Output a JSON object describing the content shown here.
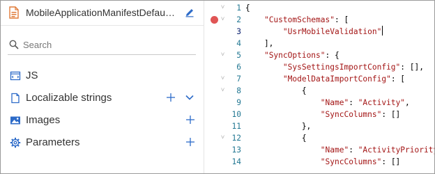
{
  "header": {
    "file_title": "MobileApplicationManifestDefault...",
    "icons": {
      "file": "file-code-icon",
      "edit": "pencil-icon"
    }
  },
  "search": {
    "placeholder": "Search",
    "value": ""
  },
  "nav": {
    "items": [
      {
        "label": "JS",
        "icon": "js-file-icon",
        "has_add": false,
        "has_expand": false
      },
      {
        "label": "Localizable strings",
        "icon": "document-icon",
        "has_add": true,
        "has_expand": true
      },
      {
        "label": "Images",
        "icon": "image-icon",
        "has_add": true,
        "has_expand": false
      },
      {
        "label": "Parameters",
        "icon": "gear-icon",
        "has_add": true,
        "has_expand": false
      }
    ]
  },
  "editor": {
    "active_line": 3,
    "breakpoint_line": 2,
    "lines": [
      {
        "n": "1",
        "fold": true,
        "text": "{"
      },
      {
        "n": "2",
        "fold": true,
        "text": "    \"CustomSchemas\": ["
      },
      {
        "n": "3",
        "fold": false,
        "text": "        \"UsrMobileValidation\""
      },
      {
        "n": "4",
        "fold": false,
        "text": "    ],"
      },
      {
        "n": "5",
        "fold": true,
        "text": "    \"SyncOptions\": {"
      },
      {
        "n": "6",
        "fold": false,
        "text": "        \"SysSettingsImportConfig\": [],"
      },
      {
        "n": "7",
        "fold": true,
        "text": "        \"ModelDataImportConfig\": ["
      },
      {
        "n": "8",
        "fold": true,
        "text": "            {"
      },
      {
        "n": "9",
        "fold": false,
        "text": "                \"Name\": \"Activity\","
      },
      {
        "n": "10",
        "fold": false,
        "text": "                \"SyncColumns\": []"
      },
      {
        "n": "11",
        "fold": false,
        "text": "            },"
      },
      {
        "n": "12",
        "fold": true,
        "text": "            {"
      },
      {
        "n": "13",
        "fold": false,
        "text": "                \"Name\": \"ActivityPriority"
      },
      {
        "n": "14",
        "fold": false,
        "text": "                \"SyncColumns\": []"
      }
    ]
  },
  "colors": {
    "string": "#a31515",
    "line_number": "#237893",
    "breakpoint": "#e05555"
  }
}
